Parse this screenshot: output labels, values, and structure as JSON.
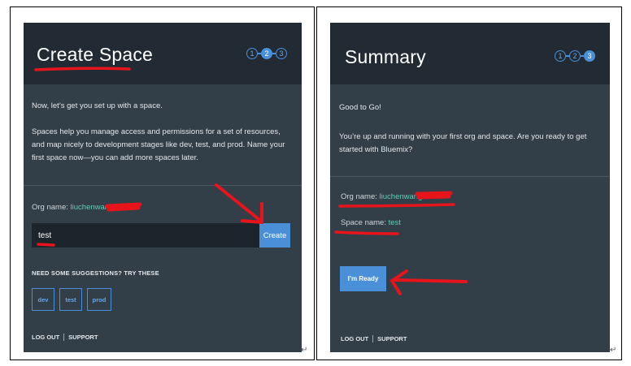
{
  "left": {
    "title": "Create Space",
    "steps": [
      "1",
      "2",
      "3"
    ],
    "intro": "Now, let’s get you set up with a space.",
    "description": "Spaces help you manage access and permissions for a set of resources, and map nicely to development stages like dev, test, and prod. Name your first space now—you can add more spaces later.",
    "org_label": "Org name:",
    "org_value": "liuchenwang1",
    "space_input_value": "test",
    "create_label": "Create",
    "suggestions_title": "NEED SOME SUGGESTIONS? TRY THESE",
    "suggestions": [
      "dev",
      "test",
      "prod"
    ],
    "footer_logout": "LOG OUT",
    "footer_support": "SUPPORT"
  },
  "right": {
    "title": "Summary",
    "steps": [
      "1",
      "2",
      "3"
    ],
    "good": "Good to Go!",
    "message": "You’re up and running with your first org and space. Are you ready to get started with Bluemix?",
    "org_label": "Org name:",
    "org_value": "liuchenwang1",
    "space_label": "Space name:",
    "space_value": "test",
    "ready_label": "I’m Ready",
    "footer_logout": "LOG OUT",
    "footer_support": "SUPPORT"
  },
  "colors": {
    "panel_bg": "#323e48",
    "header_bg": "#222b33",
    "accent_blue": "#4a90d9",
    "value_teal": "#5ad3b5",
    "annotation_red": "#e8141c"
  },
  "icons": [
    "return-mark-icon",
    "annotation-arrow-icon"
  ]
}
